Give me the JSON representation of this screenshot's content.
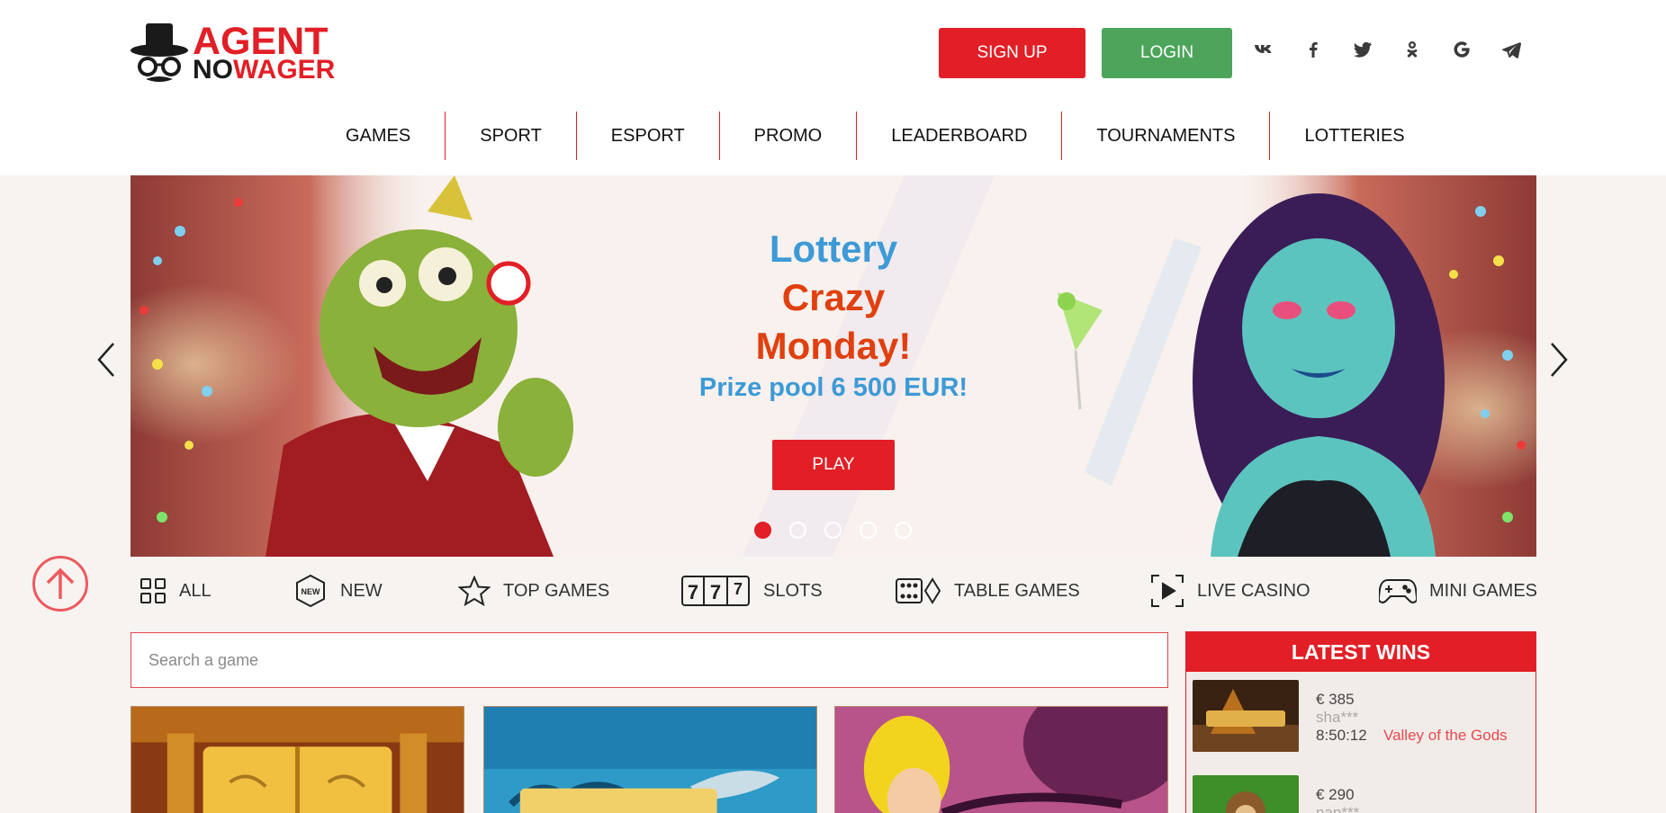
{
  "logo": {
    "line1": "AGENT",
    "line2_no": "NO",
    "line2_wager": "WAGER"
  },
  "header": {
    "signup_label": "SIGN UP",
    "login_label": "LOGIN",
    "social": [
      "vk-icon",
      "facebook-icon",
      "twitter-icon",
      "odnoklassniki-icon",
      "google-icon",
      "telegram-icon"
    ]
  },
  "nav": {
    "items": [
      "GAMES",
      "SPORT",
      "ESPORT",
      "PROMO",
      "LEADERBOARD",
      "TOURNAMENTS",
      "LOTTERIES"
    ]
  },
  "banner": {
    "line1": "Lottery",
    "line2": "Crazy",
    "line3": "Monday!",
    "line4": "Prize pool 6 500 EUR!",
    "play_label": "PLAY",
    "slides": 5,
    "active_slide": 1
  },
  "categories": [
    {
      "label": "ALL",
      "icon": "grid-icon"
    },
    {
      "label": "NEW",
      "icon": "new-badge-icon"
    },
    {
      "label": "TOP GAMES",
      "icon": "star-icon"
    },
    {
      "label": "SLOTS",
      "icon": "slots-777-icon"
    },
    {
      "label": "TABLE GAMES",
      "icon": "dice-icon"
    },
    {
      "label": "LIVE CASINO",
      "icon": "live-play-icon"
    },
    {
      "label": "MINI GAMES",
      "icon": "gamepad-icon"
    }
  ],
  "search": {
    "placeholder": "Search a game"
  },
  "wins": {
    "title": "LATEST WINS",
    "rows": [
      {
        "amount": "€ 385",
        "user": "sha***",
        "time": "8:50:12",
        "game": "Valley of the Gods"
      },
      {
        "amount": "€ 290",
        "user": "nap***",
        "time": "",
        "game": ""
      }
    ]
  },
  "colors": {
    "brand_red": "#e21f26",
    "login_green": "#4ca55a",
    "banner_blue": "#3d9ad6",
    "banner_orange": "#e0400f"
  }
}
